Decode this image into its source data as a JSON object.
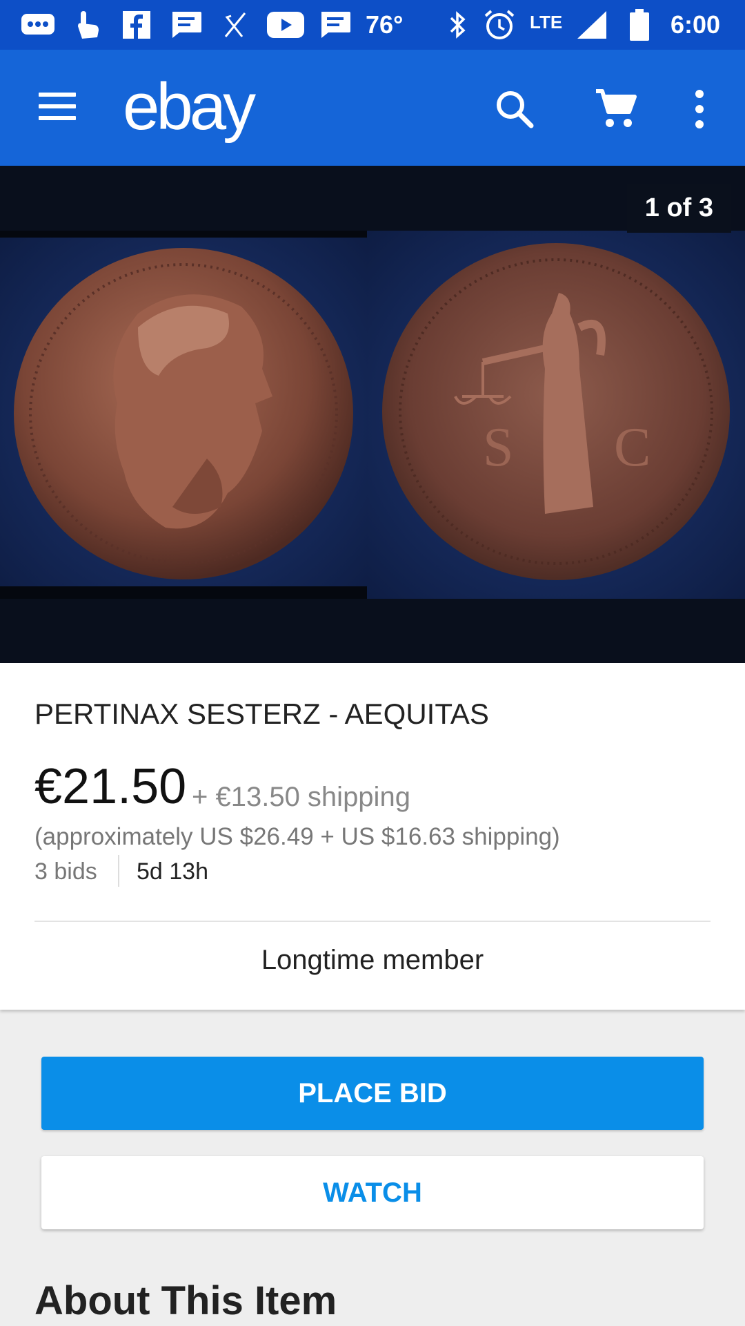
{
  "status_bar": {
    "weather_temp": "76°",
    "network": "LTE",
    "time": "6:00",
    "left_icons": [
      "messaging-icon",
      "touch-icon",
      "facebook-icon",
      "message-icon",
      "missed-call-icon",
      "youtube-icon",
      "message-icon"
    ],
    "right_icons": [
      "bluetooth-icon",
      "alarm-icon",
      "signal-icon",
      "battery-icon"
    ]
  },
  "app_bar": {
    "logo": "ebay",
    "background": "#1565d8",
    "icons": [
      "menu-icon",
      "search-icon",
      "cart-icon",
      "more-vert-icon"
    ]
  },
  "gallery": {
    "counter": "1 of 3",
    "image": "Two sides of a bronze Roman coin (portrait bust, standing figure holding scales)"
  },
  "listing": {
    "title": "PERTINAX SESTERZ - AEQUITAS",
    "price": "€21.50",
    "shipping": "+ €13.50 shipping",
    "approx": "(approximately US $26.49 + US $16.63 shipping)",
    "bids": "3 bids",
    "time_left": "5d 13h",
    "seller_badge": "Longtime member"
  },
  "actions": {
    "place_bid": "PLACE BID",
    "watch": "WATCH",
    "accent": "#0a8ee8"
  },
  "section": {
    "about_title": "About This Item"
  }
}
